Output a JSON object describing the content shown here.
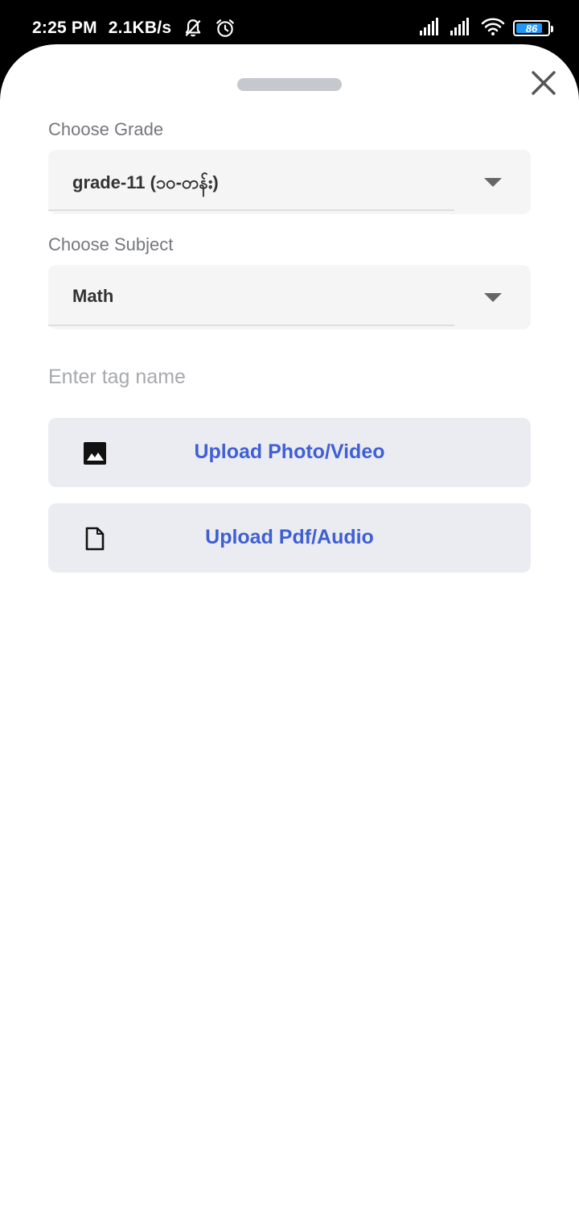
{
  "status_bar": {
    "time": "2:25 PM",
    "network_speed": "2.1KB/s",
    "battery_level": "86",
    "battery_fraction": 0.86,
    "icons": [
      "muted-bell-icon",
      "alarm-icon",
      "signal-icon",
      "signal-icon",
      "wifi-icon",
      "battery-icon"
    ]
  },
  "sheet": {
    "grade": {
      "label": "Choose Grade",
      "value": "grade-11 (၁၀-တန်း)"
    },
    "subject": {
      "label": "Choose Subject",
      "value": "Math"
    },
    "tag_input": {
      "placeholder": "Enter tag name",
      "value": ""
    },
    "upload_photo": {
      "label": "Upload Photo/Video",
      "icon": "image-icon"
    },
    "upload_pdf": {
      "label": "Upload Pdf/Audio",
      "icon": "file-icon"
    }
  },
  "colors": {
    "accent": "#3f5fd4",
    "battery": "#2196f3",
    "button_bg": "#ebecf1",
    "select_bg": "#f5f5f5"
  }
}
